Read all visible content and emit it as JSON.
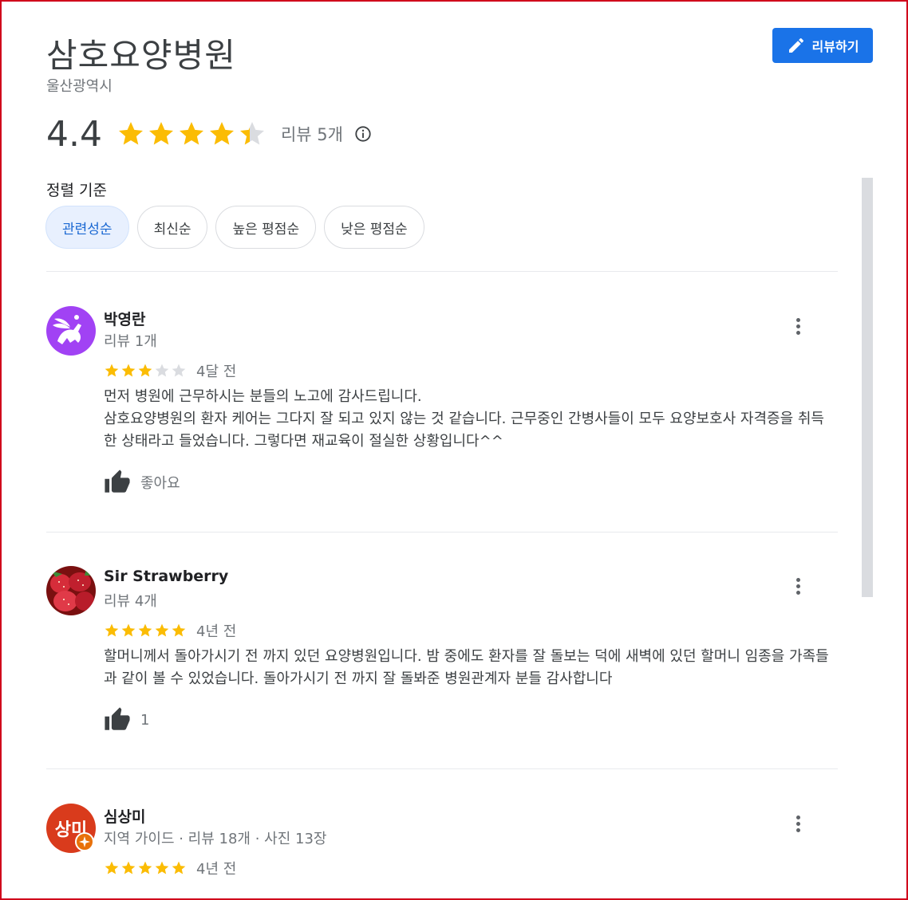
{
  "place": {
    "name": "삼호요양병원",
    "region": "울산광역시",
    "rating": "4.4",
    "rating_value": 4.4,
    "review_count_label": "리뷰 5개"
  },
  "write_review": {
    "label": "리뷰하기",
    "icon": "pencil-icon"
  },
  "sort": {
    "label": "정렬 기준",
    "options": [
      "관련성순",
      "최신순",
      "높은 평점순",
      "낮은 평점순"
    ],
    "selected": "관련성순"
  },
  "colors": {
    "star_filled": "#fbbc04",
    "star_empty": "#dadce0",
    "accent": "#1a73e8",
    "chip_active_bg": "#e8f0fe",
    "chip_active_text": "#1967d2"
  },
  "reviews": [
    {
      "name": "박영란",
      "meta": "리뷰 1개",
      "rating": 3,
      "time": "4달 전",
      "text": "먼저 병원에 근무하시는 분들의 노고에 감사드립니다.\n삼호요양병원의 환자 케어는 그다지 잘 되고 있지 않는 것 같습니다. 근무중인 간병사들이 모두 요양보호사 자격증을 취득한 상태라고 들었습니다. 그렇다면 재교육이 절실한 상황입니다^^",
      "like_label": "좋아요",
      "avatar_icon": "pegasus-avatar"
    },
    {
      "name": "Sir Strawberry",
      "meta": "리뷰 4개",
      "rating": 5,
      "time": "4년 전",
      "text": "할머니께서 돌아가시기 전 까지 있던 요양병원입니다. 밤 중에도 환자를 잘 돌보는 덕에 새벽에 있던 할머니 임종을 가족들과 같이 볼 수 있었습니다. 돌아가시기 전 까지 잘 돌봐준 병원관계자 분들 감사합니다",
      "like_label": "1",
      "avatar_icon": "strawberry-avatar"
    },
    {
      "name": "심상미",
      "meta": "지역 가이드 · 리뷰 18개 · 사진 13장",
      "rating": 5,
      "time": "4년 전",
      "avatar_text": "상미",
      "avatar_icon": "local-guide-badge-icon"
    }
  ]
}
